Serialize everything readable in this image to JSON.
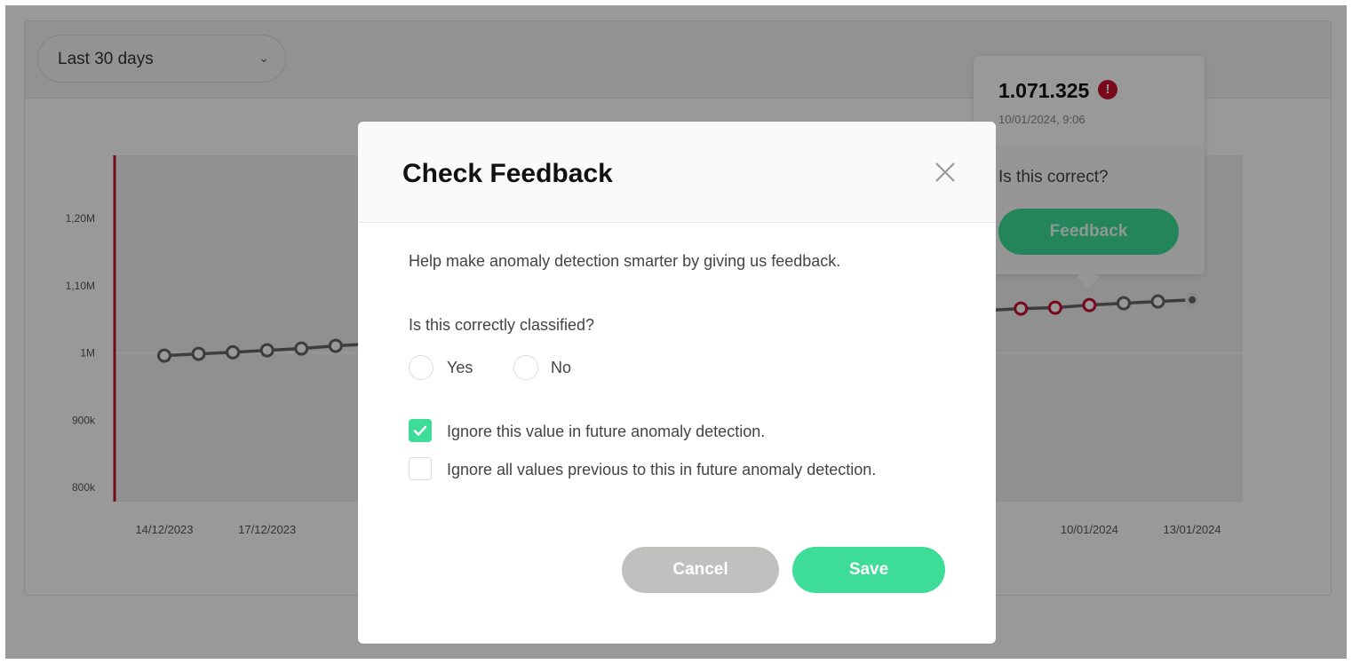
{
  "filter": {
    "range_label": "Last 30 days"
  },
  "colors": {
    "accent": "#3ddc97",
    "anomaly": "#c8102e",
    "cancel": "#c0c0bf",
    "line": "#666666"
  },
  "tooltip": {
    "value": "1.071.325",
    "alert_icon": "exclamation-circle-icon",
    "date": "10/01/2024, 9:06",
    "question": "Is this correct?",
    "button": "Feedback"
  },
  "chart_data": {
    "type": "line",
    "y_ticks": [
      "800k",
      "900k",
      "1M",
      "1,10M",
      "1,20M"
    ],
    "ylim": [
      800000,
      1250000
    ],
    "x_ticks": [
      "14/12/2023",
      "17/12/2023",
      "10/01/2024",
      "13/01/2024"
    ],
    "points": [
      {
        "date": "14/12/2023",
        "value": 996000,
        "anomaly": false
      },
      {
        "date": "15/12/2023",
        "value": 998700,
        "anomaly": false
      },
      {
        "date": "16/12/2023",
        "value": 1001000,
        "anomaly": false
      },
      {
        "date": "17/12/2023",
        "value": 1004000,
        "anomaly": false
      },
      {
        "date": "18/12/2023",
        "value": 1006600,
        "anomaly": false
      },
      {
        "date": "19/12/2023",
        "value": 1010600,
        "anomaly": false
      },
      {
        "date": "08/01/2024",
        "value": 1066000,
        "anomaly": true
      },
      {
        "date": "09/01/2024",
        "value": 1067400,
        "anomaly": true
      },
      {
        "date": "10/01/2024",
        "value": 1071325,
        "anomaly": true
      },
      {
        "date": "11/01/2024",
        "value": 1074000,
        "anomaly": false
      },
      {
        "date": "12/01/2024",
        "value": 1076600,
        "anomaly": false
      },
      {
        "date": "13/01/2024",
        "value": 1079000,
        "anomaly": false
      }
    ]
  },
  "modal": {
    "title": "Check Feedback",
    "close_icon": "close-icon",
    "description": "Help make anomaly detection smarter by giving us feedback.",
    "question": "Is this correctly classified?",
    "options": [
      "Yes",
      "No"
    ],
    "checkboxes": [
      {
        "label": "Ignore this value in future anomaly detection.",
        "checked": true
      },
      {
        "label": "Ignore all values previous to this in future anomaly detection.",
        "checked": false
      }
    ],
    "cancel": "Cancel",
    "save": "Save"
  }
}
